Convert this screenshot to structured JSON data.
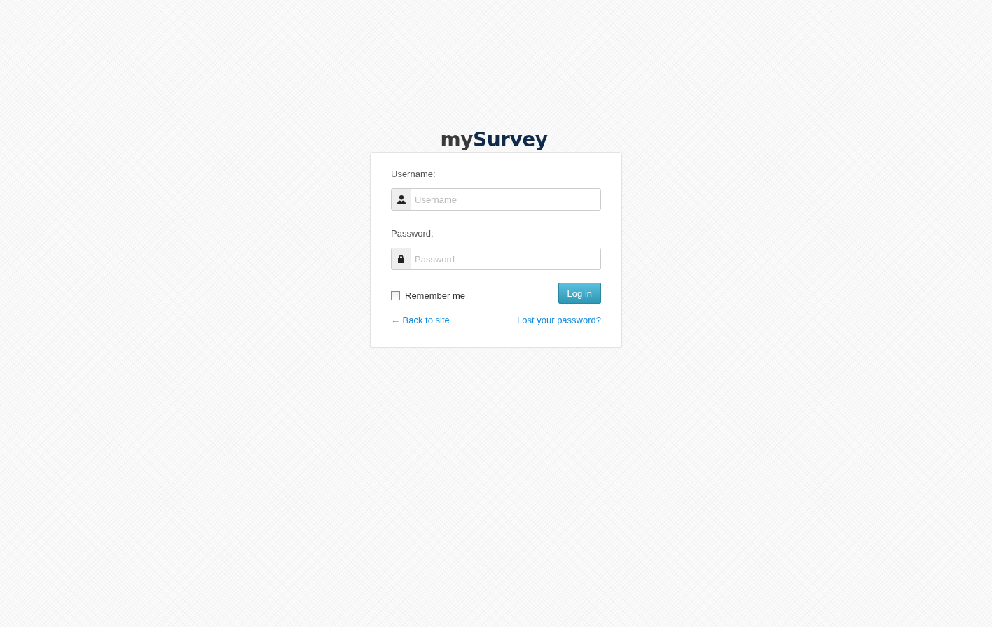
{
  "logo": {
    "parts": [
      "my",
      "Survey"
    ]
  },
  "form": {
    "fields": [
      {
        "kind": "user",
        "label": "Username:",
        "placeholder": "Username"
      },
      {
        "kind": "lock",
        "label": "Password:",
        "placeholder": "Password"
      }
    ],
    "remember": {
      "label": "Remember me",
      "checked": false
    },
    "submit": "Log in",
    "links": [
      "← Back to site",
      "Lost your password?"
    ]
  }
}
